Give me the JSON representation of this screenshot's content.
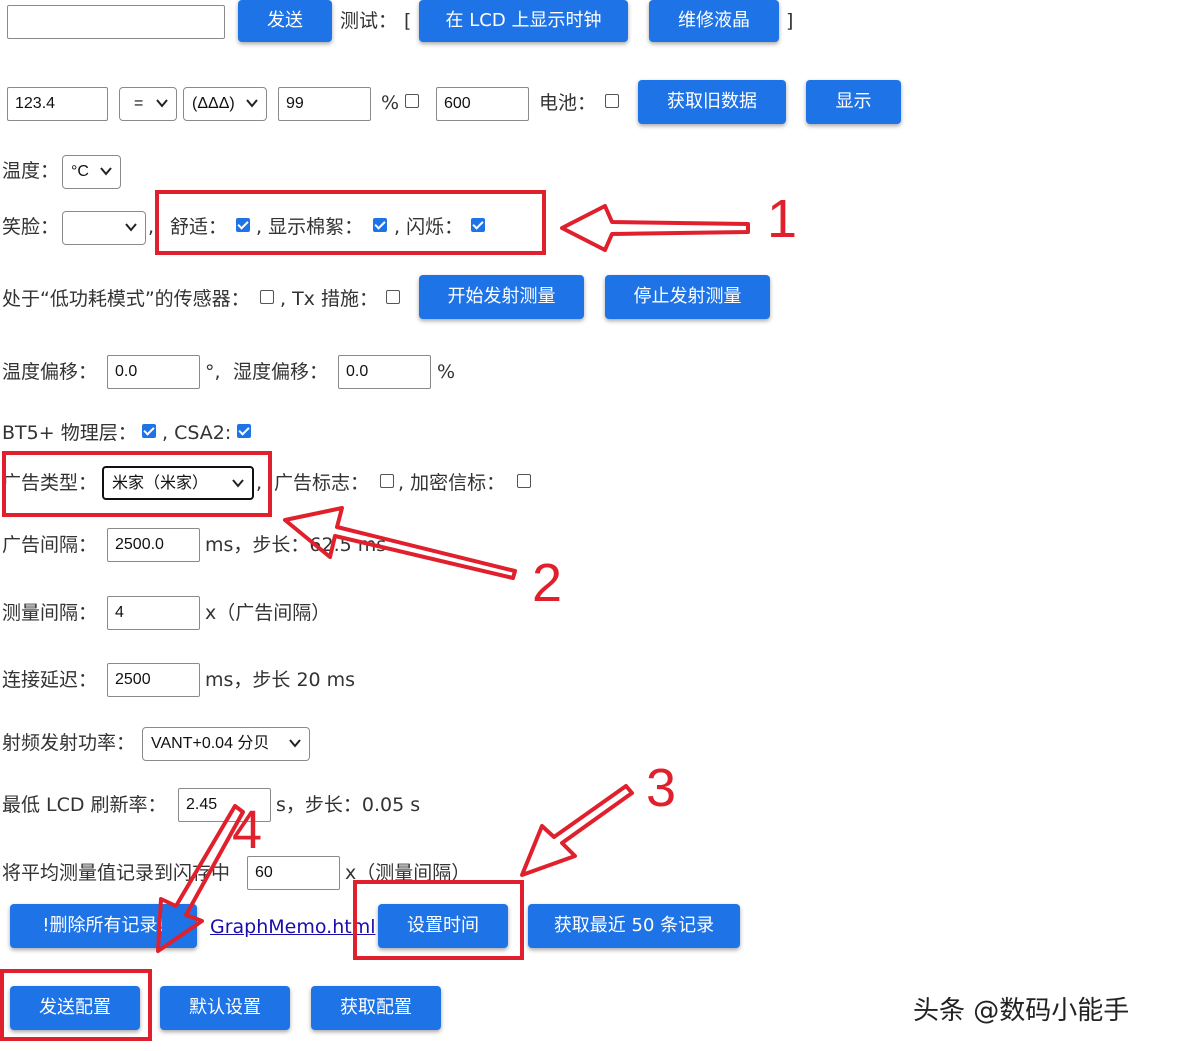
{
  "row1": {
    "text_input": "",
    "send_label": "发送",
    "test_label": "测试：",
    "bracket_open": "[",
    "clock_label": "在 LCD 上显示时钟",
    "repair_label": "维修液晶",
    "bracket_close": "]"
  },
  "row2": {
    "value": "123.4",
    "op_select": "=",
    "symbol_select": "(ΔΔΔ)",
    "humidity": "99",
    "percent": "%",
    "number": "600",
    "battery_label": "电池：",
    "get_old_label": "获取旧数据",
    "show_label": "显示"
  },
  "temp": {
    "label": "温度：",
    "unit_select": "°C"
  },
  "smile": {
    "label": "笑脸：",
    "select": "",
    "comma": ",",
    "comfort": "舒适：",
    "show_floc": ", 显示棉絮：",
    "flash": ", 闪烁："
  },
  "lowpower": {
    "label": "处于“低功耗模式”的传感器：",
    "tx": ", Tx 措施：",
    "start_label": "开始发射测量",
    "stop_label": "停止发射测量"
  },
  "offsets": {
    "temp_label": "温度偏移：",
    "temp_value": "0.0",
    "deg": "°,",
    "hum_label": "湿度偏移：",
    "hum_value": "0.0",
    "pct": "%"
  },
  "phy": {
    "label": "BT5+ 物理层：",
    "csa": ", CSA2:"
  },
  "adv_type": {
    "label": "广告类型：",
    "select": "米家（米家）",
    "comma": ",",
    "flag_label": "广告标志：",
    "enc_label": ", 加密信标："
  },
  "adv_interval": {
    "label": "广告间隔：",
    "value": "2500.0",
    "suffix": "ms，步长：62.5 ms"
  },
  "meas_interval": {
    "label": "测量间隔：",
    "value": "4",
    "suffix": "x（广告间隔）"
  },
  "conn_delay": {
    "label": "连接延迟：",
    "value": "2500",
    "suffix": "ms，步长 20 ms"
  },
  "rf_power": {
    "label": "射频发射功率：",
    "select": "VANT+0.04 分贝"
  },
  "lcd_refresh": {
    "label": "最低 LCD 刷新率：",
    "value": "2.45",
    "suffix": "s，步长：0.05 s"
  },
  "flash_log": {
    "label": "将平均测量值记录到闪存中",
    "value": "60",
    "suffix": "x（测量间隔）"
  },
  "records": {
    "delete_label": "!删除所有记录!",
    "link": "GraphMemo.html",
    "set_time_label": "设置时间",
    "get50_label": "获取最近 50 条记录"
  },
  "bottom": {
    "send_config": "发送配置",
    "default_config": "默认设置",
    "get_config": "获取配置"
  },
  "annotations": [
    "1",
    "2",
    "3",
    "4"
  ],
  "watermark": "头条 @数码小能手",
  "colors": {
    "button": "#1e73e6",
    "annotation": "#e0202c",
    "link": "#1a0dab"
  }
}
